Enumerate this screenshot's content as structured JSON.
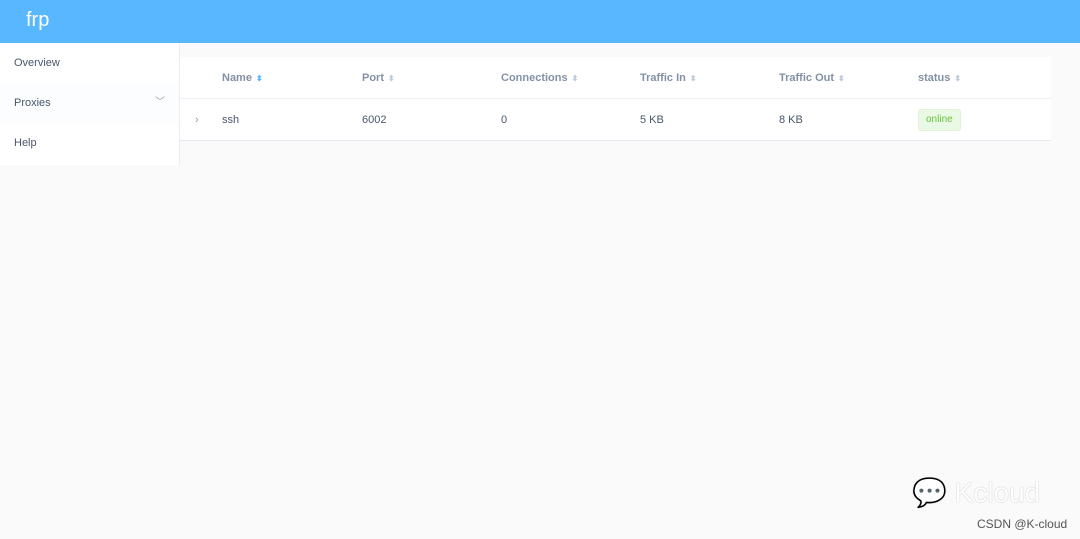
{
  "app": {
    "title": "frp"
  },
  "sidebar": {
    "items": [
      {
        "label": "Overview"
      },
      {
        "label": "Proxies"
      },
      {
        "label": "Help"
      }
    ]
  },
  "table": {
    "columns": [
      "Name",
      "Port",
      "Connections",
      "Traffic In",
      "Traffic Out",
      "status"
    ],
    "rows": [
      {
        "name": "ssh",
        "port": "6002",
        "connections": "0",
        "traffic_in": "5 KB",
        "traffic_out": "8 KB",
        "status": "online"
      }
    ]
  },
  "watermark": {
    "brand": "Kcloud",
    "credit": "CSDN @K-cloud"
  }
}
